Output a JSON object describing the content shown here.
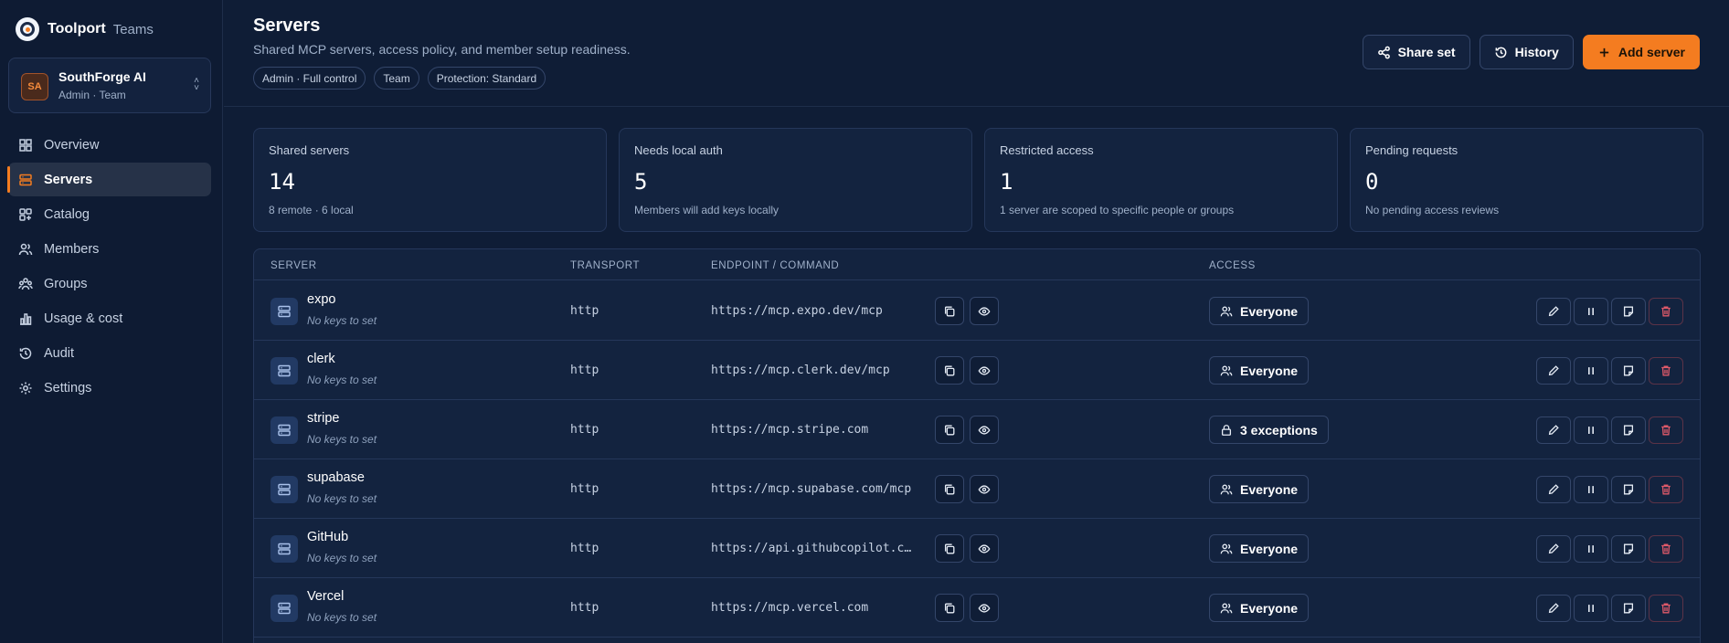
{
  "brand": {
    "name": "Toolport",
    "sub": "Teams"
  },
  "org": {
    "initials": "SA",
    "name": "SouthForge AI",
    "role": "Admin · Team"
  },
  "nav": [
    {
      "label": "Overview",
      "icon": "grid-icon"
    },
    {
      "label": "Servers",
      "icon": "server-icon",
      "active": true
    },
    {
      "label": "Catalog",
      "icon": "catalog-icon"
    },
    {
      "label": "Members",
      "icon": "users-icon"
    },
    {
      "label": "Groups",
      "icon": "groups-icon"
    },
    {
      "label": "Usage & cost",
      "icon": "bar-chart-icon"
    },
    {
      "label": "Audit",
      "icon": "history-icon"
    },
    {
      "label": "Settings",
      "icon": "gear-icon"
    }
  ],
  "header": {
    "title": "Servers",
    "subtitle": "Shared MCP servers, access policy, and member setup readiness.",
    "chips": [
      "Admin · Full control",
      "Team",
      "Protection: Standard"
    ],
    "share_label": "Share set",
    "history_label": "History",
    "add_label": "Add server"
  },
  "stats": [
    {
      "label": "Shared servers",
      "value": "14",
      "note": "8 remote · 6 local"
    },
    {
      "label": "Needs local auth",
      "value": "5",
      "note": "Members will add keys locally"
    },
    {
      "label": "Restricted access",
      "value": "1",
      "note": "1 server are scoped to specific people or groups"
    },
    {
      "label": "Pending requests",
      "value": "0",
      "note": "No pending access reviews"
    }
  ],
  "table": {
    "headers": {
      "server": "SERVER",
      "transport": "TRANSPORT",
      "endpoint": "ENDPOINT / COMMAND",
      "access": "ACCESS"
    },
    "rows": [
      {
        "name": "expo",
        "keys": "No keys to set",
        "transport": "http",
        "endpoint": "https://mcp.expo.dev/mcp",
        "access": "Everyone",
        "access_icon": "users-icon"
      },
      {
        "name": "clerk",
        "keys": "No keys to set",
        "transport": "http",
        "endpoint": "https://mcp.clerk.dev/mcp",
        "access": "Everyone",
        "access_icon": "users-icon"
      },
      {
        "name": "stripe",
        "keys": "No keys to set",
        "transport": "http",
        "endpoint": "https://mcp.stripe.com",
        "access": "3 exceptions",
        "access_icon": "lock-icon"
      },
      {
        "name": "supabase",
        "keys": "No keys to set",
        "transport": "http",
        "endpoint": "https://mcp.supabase.com/mcp",
        "access": "Everyone",
        "access_icon": "users-icon"
      },
      {
        "name": "GitHub",
        "keys": "No keys to set",
        "transport": "http",
        "endpoint": "https://api.githubcopilot.c…",
        "access": "Everyone",
        "access_icon": "users-icon"
      },
      {
        "name": "Vercel",
        "keys": "No keys to set",
        "transport": "http",
        "endpoint": "https://mcp.vercel.com",
        "access": "Everyone",
        "access_icon": "users-icon"
      }
    ]
  },
  "colors": {
    "accent": "#f47c20",
    "background": "#0f1d36",
    "danger": "#e05a6a"
  }
}
